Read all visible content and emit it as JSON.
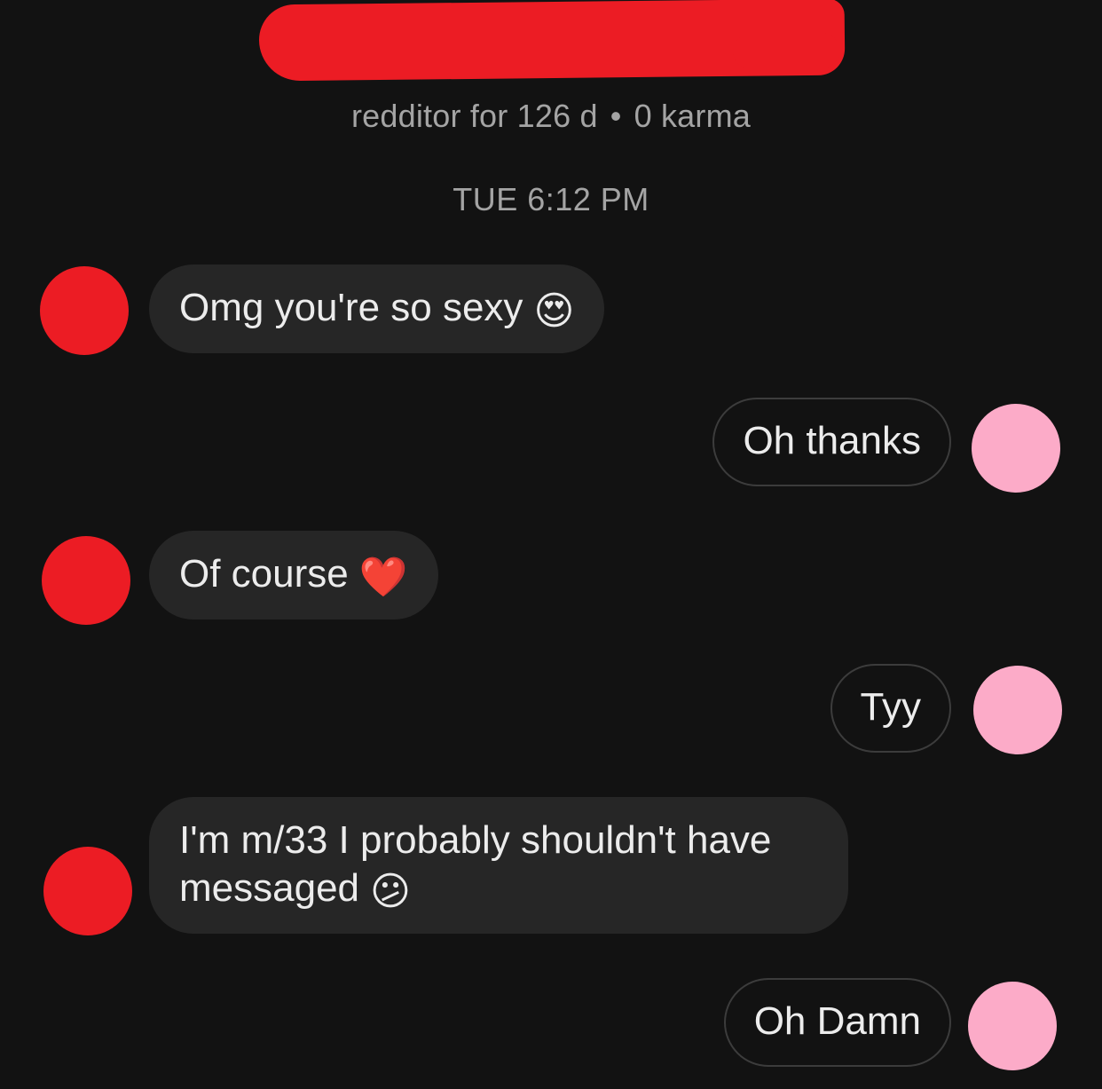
{
  "header": {
    "name_redacted": "",
    "meta_left": "redditor for 126 d",
    "meta_sep": "•",
    "meta_right": "0 karma"
  },
  "timestamp": "TUE 6:12 PM",
  "messages": [
    {
      "from": "them",
      "text": "Omg you're so sexy",
      "emoji": "😍"
    },
    {
      "from": "me",
      "text": "Oh thanks"
    },
    {
      "from": "them",
      "text": "Of course",
      "emoji": "❤️"
    },
    {
      "from": "me",
      "text": "Tyy"
    },
    {
      "from": "them",
      "line1": "I'm m/33 I probably shouldn't have",
      "line2": "messaged",
      "emoji": "😕"
    },
    {
      "from": "me",
      "text": "Oh Damn"
    }
  ],
  "colors": {
    "background": "#121212",
    "incoming_bubble": "#262626",
    "outgoing_border": "#3c3c3c",
    "redaction": "#ec1c24",
    "my_avatar": "#fcabc8"
  }
}
